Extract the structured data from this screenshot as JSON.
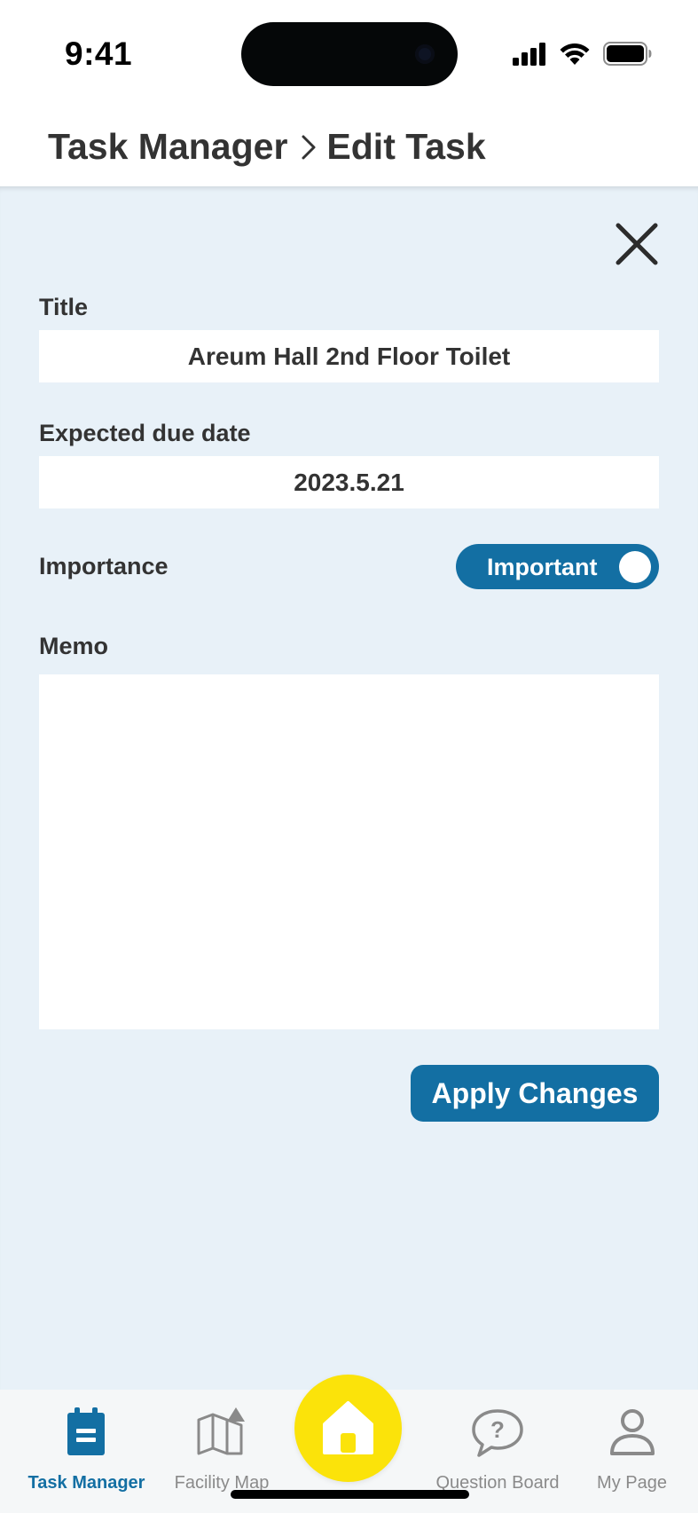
{
  "status_bar": {
    "time": "9:41",
    "icons": [
      "cellular-signal-icon",
      "wifi-icon",
      "battery-icon"
    ]
  },
  "header": {
    "breadcrumb": {
      "parent": "Task Manager",
      "separator_icon": "chevron-right-icon",
      "current": "Edit Task"
    }
  },
  "form": {
    "close_icon": "close-icon",
    "title": {
      "label": "Title",
      "value": "Areum Hall 2nd Floor Toilet"
    },
    "due_date": {
      "label": "Expected due date",
      "value": "2023.5.21"
    },
    "importance": {
      "label": "Importance",
      "toggle_label": "Important",
      "enabled": true
    },
    "memo": {
      "label": "Memo",
      "value": ""
    },
    "apply_label": "Apply Changes"
  },
  "bottom_nav": {
    "items": [
      {
        "label": "Task Manager",
        "icon": "clipboard-icon",
        "active": true
      },
      {
        "label": "Facility Map",
        "icon": "map-icon",
        "active": false
      },
      {
        "label": "",
        "icon": "home-icon",
        "active": false
      },
      {
        "label": "Question Board",
        "icon": "question-bubble-icon",
        "active": false
      },
      {
        "label": "My Page",
        "icon": "person-icon",
        "active": false
      }
    ]
  },
  "colors": {
    "accent": "#136fa3",
    "panel_background": "#e8f1f8",
    "home_button": "#fbe30a",
    "inactive_nav": "#8a8a8a"
  }
}
